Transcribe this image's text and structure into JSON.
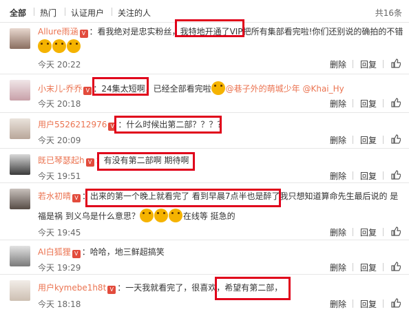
{
  "tabs": [
    {
      "label": "全部"
    },
    {
      "label": "热门"
    },
    {
      "label": "认证用户"
    },
    {
      "label": "关注的人"
    }
  ],
  "total": "共16条",
  "actions": {
    "delete": "删除",
    "reply": "回复"
  },
  "comments": [
    {
      "user": "Allure雨涵",
      "t1": "：看我绝对是忠实粉丝，",
      "hl": "我特地开通了VIP",
      "t2": "把所有集部看完啦!你们还别说的确拍的不错",
      "time": "今天 20:22"
    },
    {
      "user": "小末儿-乔乔",
      "t1": "：",
      "hl": "24集太短啊",
      "t2": "，已经全部看完啦",
      "mention": "@巷子外的萌城少年 @Khai_Hy",
      "time": "今天 20:18"
    },
    {
      "user": "用户5526212976",
      "t1": "：",
      "hl": "什么时候出第二部？？？？",
      "time": "今天 20:09"
    },
    {
      "user": "既已琴瑟起h",
      "t1": "：",
      "hl": "有没有第二部啊 期待啊",
      "time": "今天 19:51"
    },
    {
      "user": "若水初晴",
      "t1": "：",
      "hl": "出来的第一个晚上就看完了 看到早晨7点半也是醉了",
      "t2": "我只想知道算命先生最后说的 是",
      "t3": "福是祸 到义乌是什么意思？",
      "t4": "在线等 挺急的",
      "time": "今天 19:45"
    },
    {
      "user": "AI白狐狸",
      "t1": "：哈哈，地三鲜超搞笑",
      "time": "今天 19:29"
    },
    {
      "user": "用户kymebe1h8t",
      "t1": "：一天我就看完了，很喜欢，",
      "hl": "希望有第二部，",
      "time": "今天 18:18"
    }
  ]
}
